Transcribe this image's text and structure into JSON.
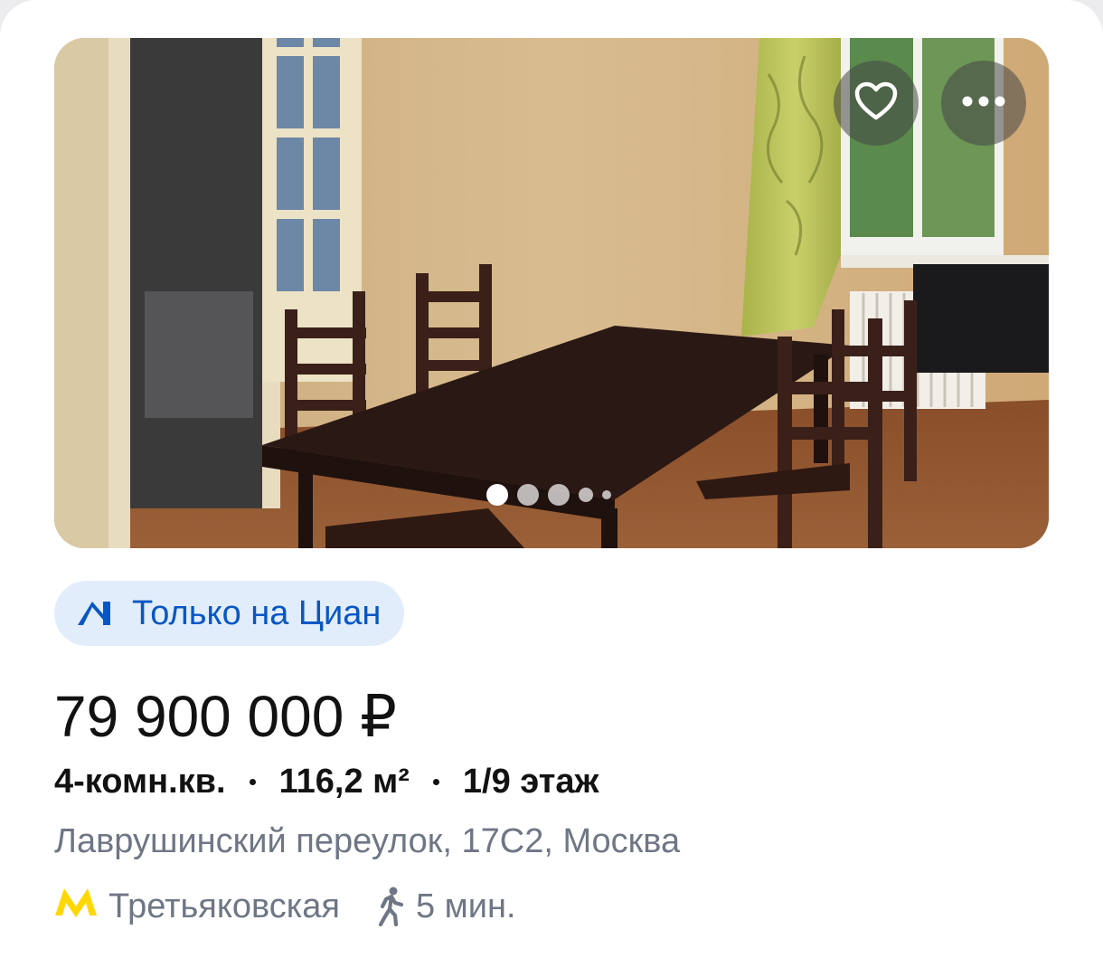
{
  "listing": {
    "photo": {
      "favorite_icon": "heart-outline-icon",
      "more_icon": "more-horizontal-icon",
      "slide_count": 5,
      "active_slide": 1
    },
    "badge": {
      "icon": "cian-logo-icon",
      "text": "Только на Циан"
    },
    "price": "79 900 000 ₽",
    "specs": {
      "rooms": "4-комн.кв.",
      "area": "116,2 м²",
      "floor": "1/9 этаж"
    },
    "address": "Лаврушинский переулок, 17С2, Москва",
    "metro": {
      "icon": "moscow-metro-icon",
      "line_color": "#ffd803",
      "station": "Третьяковская",
      "walk_icon": "walking-person-icon",
      "walk_time": "5 мин."
    }
  },
  "colors": {
    "accent": "#0957c4",
    "badge_bg": "#e2edfc",
    "secondary_text": "#6f7685",
    "primary_text": "#121212"
  }
}
